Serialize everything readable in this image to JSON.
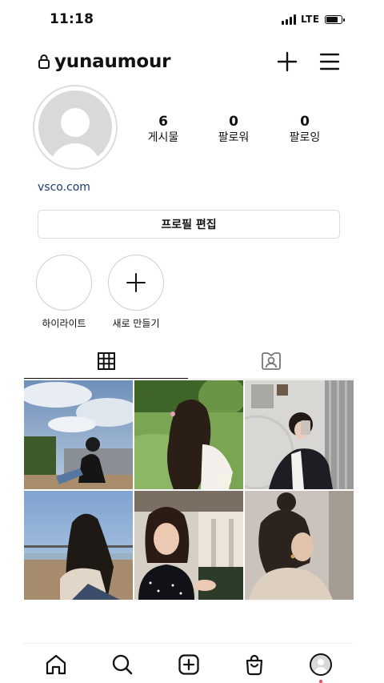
{
  "status_bar": {
    "time": "11:18",
    "network": "LTE",
    "battery_level": 0.85
  },
  "header": {
    "username": "yunaumour",
    "lock_icon": "lock-icon",
    "new_post_icon": "plus-icon",
    "menu_icon": "hamburger-menu-icon"
  },
  "profile": {
    "stats": [
      {
        "value": "6",
        "label": "게시물"
      },
      {
        "value": "0",
        "label": "팔로워"
      },
      {
        "value": "0",
        "label": "팔로잉"
      }
    ],
    "website": "vsco.com",
    "edit_label": "프로필 편집"
  },
  "highlights": [
    {
      "label": "하이라이트",
      "kind": "empty"
    },
    {
      "label": "새로 만들기",
      "kind": "new"
    }
  ],
  "tabs": [
    {
      "name": "grid",
      "icon": "grid-icon",
      "active": true
    },
    {
      "name": "tagged",
      "icon": "tagged-person-icon",
      "active": false
    }
  ],
  "posts": [
    {
      "id": 1,
      "subject": "girl in black sitting on ledge under cloudy sky"
    },
    {
      "id": 2,
      "subject": "long-haired girl seen from behind on grass field"
    },
    {
      "id": 3,
      "subject": "mirror selfie in dark blazer"
    },
    {
      "id": 4,
      "subject": "girl from behind sitting on balcony railing"
    },
    {
      "id": 5,
      "subject": "girl in polka-dot top on terrace"
    },
    {
      "id": 6,
      "subject": "woman with hair bun looking down"
    }
  ],
  "bottom_nav": [
    "home-icon",
    "search-icon",
    "new-post-icon",
    "shop-icon",
    "profile-avatar"
  ],
  "colors": {
    "link": "#1e3a6b",
    "notification_dot": "#ed4956"
  }
}
